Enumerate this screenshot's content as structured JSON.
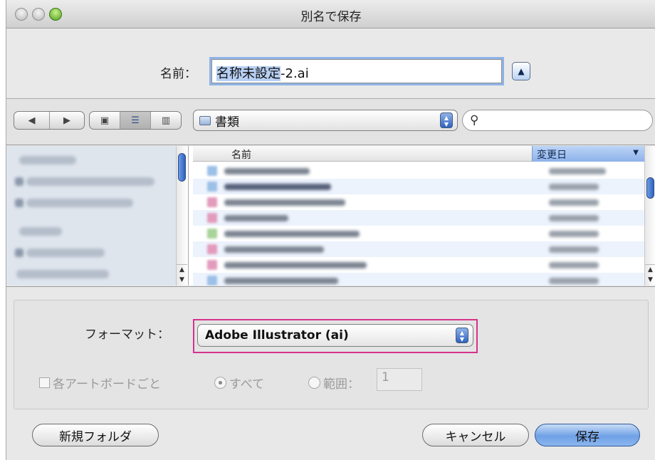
{
  "window": {
    "title": "別名で保存"
  },
  "save_name": {
    "label": "名前：",
    "value_selected": "名称未設定",
    "value_rest": "-2.ai",
    "expand_icon": "▲"
  },
  "toolbar": {
    "back_icon": "◀",
    "forward_icon": "▶",
    "icon_view": "▣",
    "list_view": "☰",
    "column_view": "▥",
    "location": "書類",
    "search_icon": "🔍",
    "search_placeholder": ""
  },
  "file_list": {
    "col_name": "名前",
    "col_date": "変更日",
    "sort_indicator": "▼",
    "scroll_up": "▲",
    "scroll_down": "▼"
  },
  "options": {
    "format_label": "フォーマット：",
    "format_value": "Adobe Illustrator (ai)",
    "artboards_label": "各アートボードごと",
    "all_label": "すべて",
    "range_label": "範囲：",
    "range_value": "1"
  },
  "buttons": {
    "new_folder": "新規フォルダ",
    "cancel": "キャンセル",
    "save": "保存"
  },
  "colors": {
    "highlight": "#d6338d",
    "accent": "#6fa1e6"
  }
}
